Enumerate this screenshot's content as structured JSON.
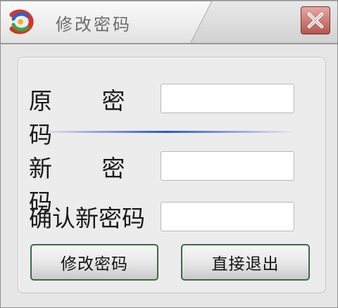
{
  "window": {
    "title": "修改密码",
    "close_icon": "close-icon"
  },
  "form": {
    "old_password_label": "原 密 码",
    "new_password_label": "新 密 码",
    "confirm_password_label": "确认新密码",
    "old_password_value": "",
    "new_password_value": "",
    "confirm_password_value": ""
  },
  "buttons": {
    "change_password_label": "修改密码",
    "exit_label": "直接退出"
  },
  "colors": {
    "close_button": "#b4564f",
    "button_border": "#3b6b43",
    "divider": "#2c55c8"
  }
}
